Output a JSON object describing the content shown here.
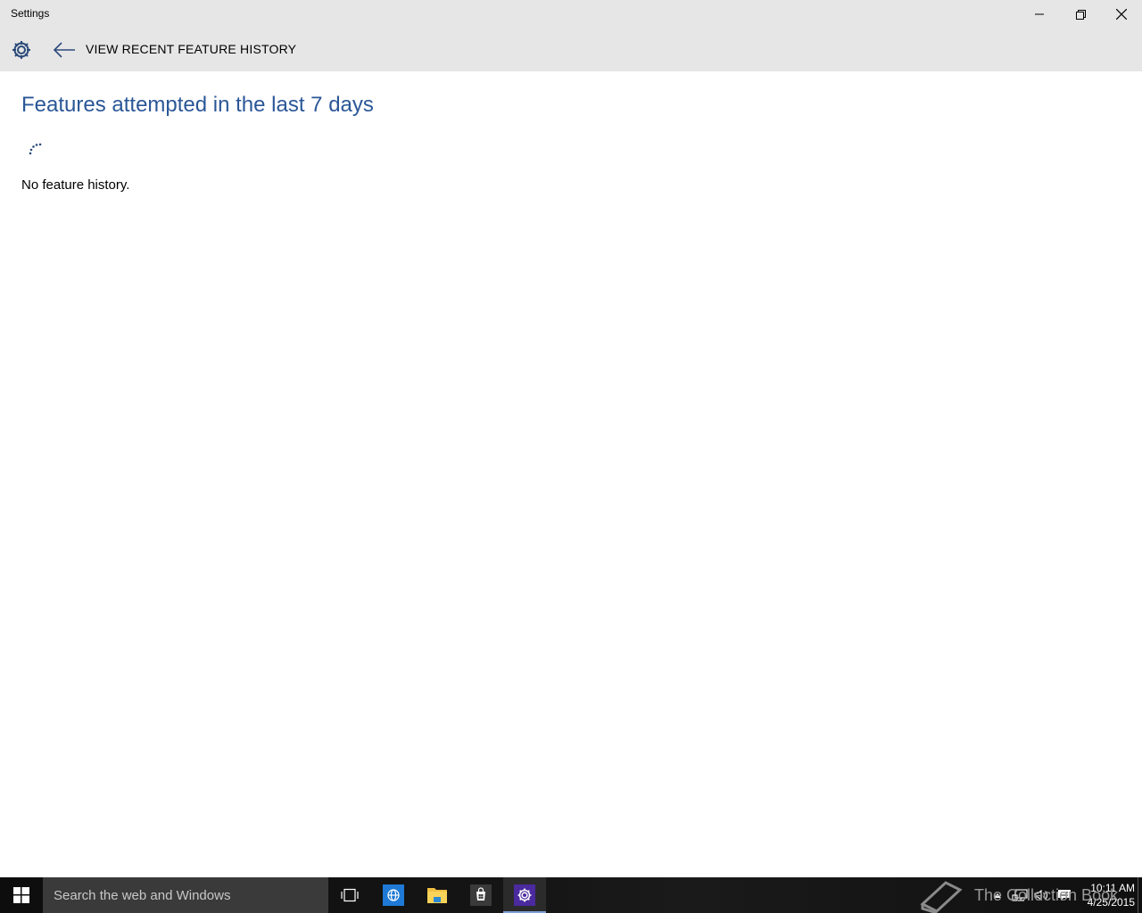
{
  "window": {
    "title": "Settings"
  },
  "header": {
    "page_title": "VIEW RECENT FEATURE HISTORY"
  },
  "main": {
    "section_title": "Features attempted in the last 7 days",
    "empty_message": "No feature history."
  },
  "taskbar": {
    "search_placeholder": "Search the web and Windows",
    "clock_time": "10:11 AM",
    "clock_date": "4/25/2015",
    "watermark_text": "The Collection Book"
  },
  "colors": {
    "accent": "#2b5797",
    "titlebar_bg": "#e6e6e6",
    "taskbar_bg": "#111111",
    "active_app_bg": "#4a2a9e"
  },
  "icons": {
    "settings": "gear-icon",
    "back": "back-arrow-icon",
    "start": "windows-logo-icon",
    "task_view": "task-view-icon",
    "ie": "internet-explorer-icon",
    "explorer": "file-explorer-icon",
    "store": "store-icon"
  }
}
